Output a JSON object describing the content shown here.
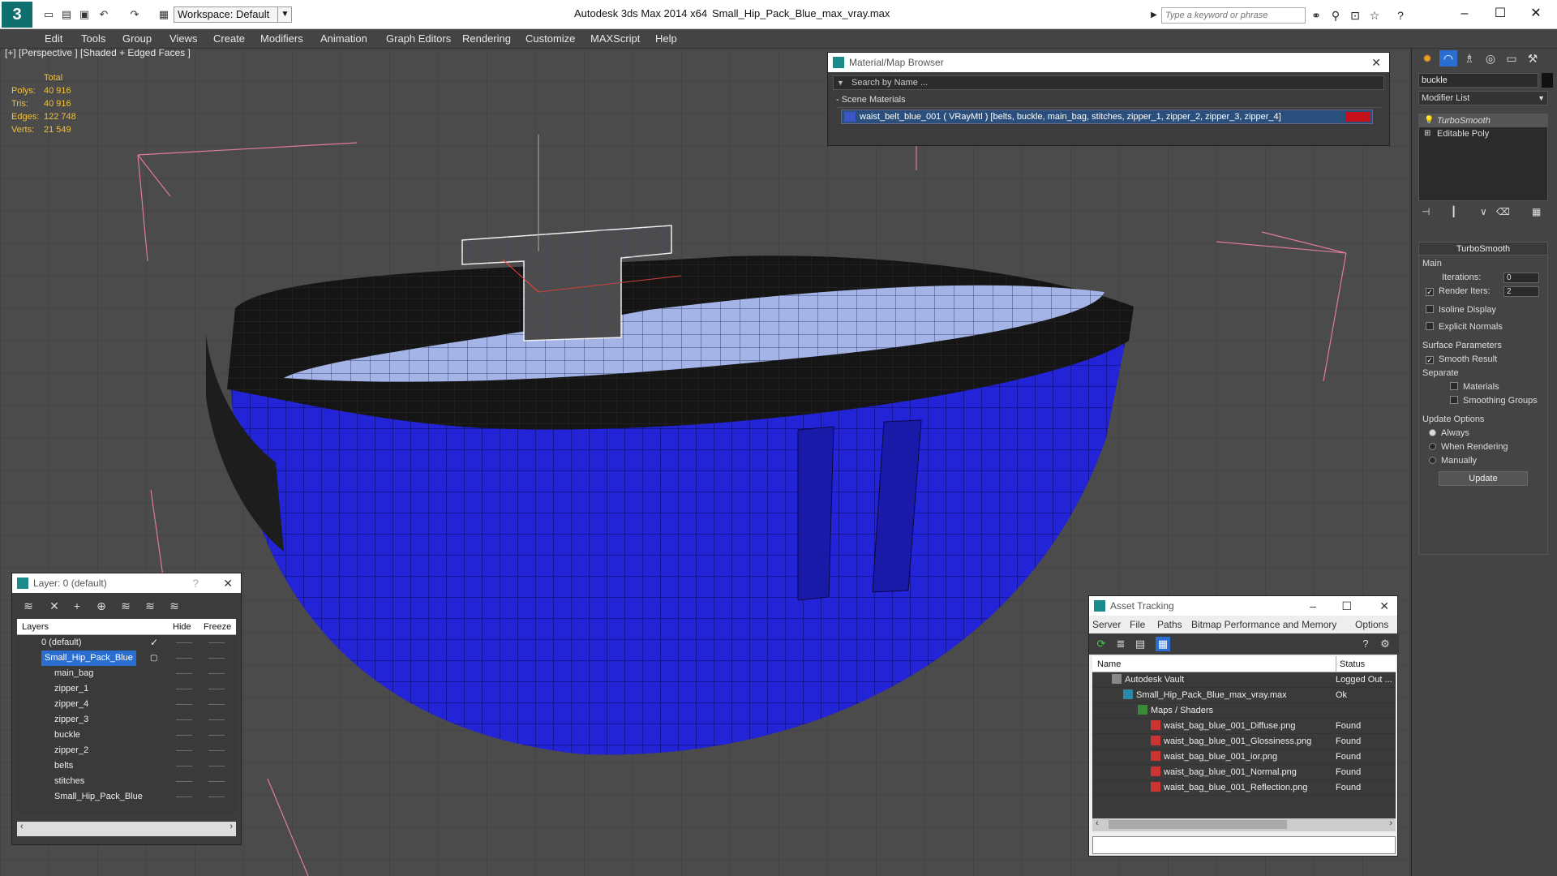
{
  "titlebar": {
    "workspace": "Workspace: Default",
    "app_title": "Autodesk 3ds Max  2014 x64",
    "file_title": "Small_Hip_Pack_Blue_max_vray.max",
    "search_placeholder": "Type a keyword or phrase"
  },
  "menu": [
    "Edit",
    "Tools",
    "Group",
    "Views",
    "Create",
    "Modifiers",
    "Animation",
    "Graph Editors",
    "Rendering",
    "Customize",
    "MAXScript",
    "Help"
  ],
  "viewport": {
    "label": "[+] [Perspective ] [Shaded + Edged Faces ]",
    "stats": {
      "header": "Total",
      "rows": [
        {
          "label": "Polys:",
          "value": "40 916"
        },
        {
          "label": "Tris:",
          "value": "40 916"
        },
        {
          "label": "Edges:",
          "value": "122 748"
        },
        {
          "label": "Verts:",
          "value": "21 549"
        }
      ]
    }
  },
  "material_browser": {
    "title": "Material/Map Browser",
    "search_placeholder": "Search by Name ...",
    "group": "- Scene Materials",
    "material": "waist_belt_blue_001  ( VRayMtl )  [belts, buckle, main_bag, stitches, zipper_1, zipper_2, zipper_3, zipper_4]",
    "swatch_color": "#c4101a"
  },
  "command_panel": {
    "object_name": "buckle",
    "modifier_list": "Modifier List",
    "stack": [
      "TurboSmooth",
      "Editable Poly"
    ],
    "turbosmooth": {
      "title": "TurboSmooth",
      "main": "Main",
      "iterations_label": "Iterations:",
      "iterations": "0",
      "render_iters_label": "Render Iters:",
      "render_iters": "2",
      "isoline": "Isoline Display",
      "explicit": "Explicit Normals",
      "surface": "Surface Parameters",
      "smooth_result": "Smooth Result",
      "separate": "Separate",
      "materials": "Materials",
      "smoothing_groups": "Smoothing Groups",
      "update_options": "Update Options",
      "always": "Always",
      "when_rendering": "When Rendering",
      "manually": "Manually",
      "update_btn": "Update"
    }
  },
  "layers": {
    "title": "Layer: 0 (default)",
    "help": "?",
    "headers": {
      "layers": "Layers",
      "hide": "Hide",
      "freeze": "Freeze"
    },
    "rows": [
      {
        "name": "0 (default)",
        "indent": 0
      },
      {
        "name": "Small_Hip_Pack_Blue",
        "indent": 0,
        "selected": true
      },
      {
        "name": "main_bag",
        "indent": 1
      },
      {
        "name": "zipper_1",
        "indent": 1
      },
      {
        "name": "zipper_4",
        "indent": 1
      },
      {
        "name": "zipper_3",
        "indent": 1
      },
      {
        "name": "buckle",
        "indent": 1
      },
      {
        "name": "zipper_2",
        "indent": 1
      },
      {
        "name": "belts",
        "indent": 1
      },
      {
        "name": "stitches",
        "indent": 1
      },
      {
        "name": "Small_Hip_Pack_Blue",
        "indent": 1
      }
    ]
  },
  "asset_tracking": {
    "title": "Asset Tracking",
    "menu": [
      "Server",
      "File",
      "Paths",
      "Bitmap Performance and Memory",
      "Options"
    ],
    "headers": {
      "name": "Name",
      "status": "Status"
    },
    "rows": [
      {
        "name": "Autodesk Vault",
        "status": "Logged Out ...",
        "indent": 1,
        "icon": "vault"
      },
      {
        "name": "Small_Hip_Pack_Blue_max_vray.max",
        "status": "Ok",
        "indent": 2,
        "icon": "max"
      },
      {
        "name": "Maps / Shaders",
        "status": "",
        "indent": 3,
        "icon": "folder"
      },
      {
        "name": "waist_bag_blue_001_Diffuse.png",
        "status": "Found",
        "indent": 4,
        "icon": "png"
      },
      {
        "name": "waist_bag_blue_001_Glossiness.png",
        "status": "Found",
        "indent": 4,
        "icon": "png"
      },
      {
        "name": "waist_bag_blue_001_ior.png",
        "status": "Found",
        "indent": 4,
        "icon": "png"
      },
      {
        "name": "waist_bag_blue_001_Normal.png",
        "status": "Found",
        "indent": 4,
        "icon": "png"
      },
      {
        "name": "waist_bag_blue_001_Reflection.png",
        "status": "Found",
        "indent": 4,
        "icon": "png"
      }
    ]
  }
}
